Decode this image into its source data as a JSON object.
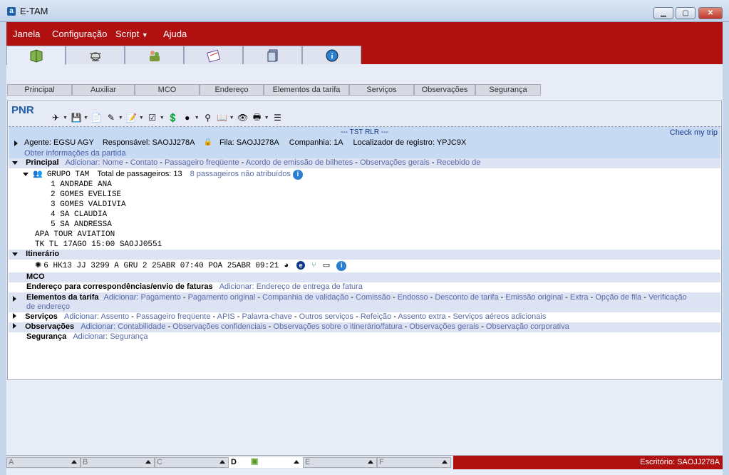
{
  "window": {
    "title": "E-TAM",
    "app_icon": "a"
  },
  "menu": [
    "Janela",
    "Configuração",
    "Script",
    "Ajuda"
  ],
  "big_tabs": [
    {
      "icon": "book-icon"
    },
    {
      "icon": "bug-icon"
    },
    {
      "icon": "people-icon"
    },
    {
      "icon": "ticket-icon"
    },
    {
      "icon": "files-icon"
    },
    {
      "icon": "info-icon"
    }
  ],
  "sub_tabs": [
    "Principal",
    "Auxiliar",
    "MCO",
    "Endereço",
    "Elementos da tarifa",
    "Serviços",
    "Observações",
    "Segurança"
  ],
  "pnr": {
    "title": "PNR",
    "rlr_label": "--- TST RLR ---",
    "check_trip": "Check my trip",
    "agent": "Agente: EGSU AGY",
    "responsavel": "Responsável: SAOJJ278A",
    "fila": "Fila: SAOJJ278A",
    "companhia": "Companhia: 1A",
    "localizador": "Localizador de registro: YPJC9X",
    "obter": "Obter informações da partida"
  },
  "principal": {
    "label": "Principal",
    "add_label": "Adicionar:",
    "links": [
      "Nome",
      "Contato",
      "Passageiro freqüente",
      "Acordo de emissão de bilhetes",
      "Observações gerais",
      "Recebido de"
    ],
    "group_name": "GRUPO TAM",
    "total_pax": "Total de passageiros: 13",
    "unassigned": "8 passageiros não atribuídos",
    "passengers": [
      "1 ANDRADE ANA",
      "2 GOMES EVELISE",
      "3 GOMES VALDIVIA",
      "4 SA CLAUDIA",
      "5 SA ANDRESSA"
    ],
    "agency": "APA TOUR AVIATION",
    "tk": "TK TL 17AGO 15:00 SAOJJ0551"
  },
  "itinerario": {
    "label": "Itinerário",
    "segment": "6  HK13  JJ   3299   A  GRU   2  25ABR  07:40   POA 25ABR  09:21"
  },
  "sections": {
    "mco": "MCO",
    "endereco": {
      "label": "Endereço para correspondências/envio de faturas",
      "add": "Adicionar:",
      "links": [
        "Endereço de entrega de fatura"
      ]
    },
    "tarifa": {
      "label": "Elementos da tarifa",
      "add": "Adicionar:",
      "links": [
        "Pagamento",
        "Pagamento original",
        "Companhia de validação",
        "Comissão",
        "Endosso",
        "Desconto de tarifa",
        "Emissão original",
        "Extra",
        "Opção de fila",
        "Verificação de endereço"
      ]
    },
    "servicos": {
      "label": "Serviços",
      "add": "Adicionar:",
      "links": [
        "Assento",
        "Passageiro freqüente",
        "APIS",
        "Palavra-chave",
        "Outros serviços",
        "Refeição",
        "Assento extra",
        "Serviços aéreos adicionais"
      ]
    },
    "observacoes": {
      "label": "Observações",
      "add": "Adicionar:",
      "links": [
        "Contabilidade",
        "Observações confidenciais",
        "Observações sobre o itinerário/fatura",
        "Observações gerais",
        "Observação corporativa"
      ]
    },
    "seguranca": {
      "label": "Segurança",
      "add": "Adicionar:",
      "links": [
        "Segurança"
      ]
    }
  },
  "bottom_slots": [
    "A",
    "B",
    "C",
    "D",
    "E",
    "F"
  ],
  "office": "Escritório: SAOJJ278A",
  "colors": {
    "brand_red": "#b01010",
    "link_blue": "#4a63b0",
    "panel_blue": "#c7daf3"
  }
}
